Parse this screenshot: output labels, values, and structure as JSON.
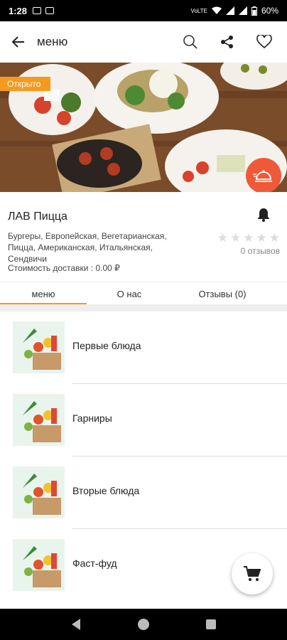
{
  "status_bar": {
    "time": "1:28",
    "battery": "60%",
    "network": "VoLTE"
  },
  "app_bar": {
    "title": "меню",
    "back_icon": "arrow-left-icon",
    "search_icon": "search-icon",
    "share_icon": "share-icon",
    "favorite_icon": "heart-icon"
  },
  "hero": {
    "badge": "Открыто",
    "delivery_icon": "delivery-cloche-icon"
  },
  "restaurant": {
    "name": "ЛАВ Пицца",
    "cuisines": "Бургеры, Европейская, Вегетарианская, Пицца, Американская, Итальянская, Сендвичи",
    "delivery_cost": "Стоимость доставки : 0.00 ₽",
    "rating": 0,
    "reviews": "0 отзывов",
    "bell_icon": "bell-icon"
  },
  "tabs": [
    {
      "label": "меню",
      "active": true
    },
    {
      "label": "О нас",
      "active": false
    },
    {
      "label": "Отзывы (0)",
      "active": false
    }
  ],
  "menu": [
    {
      "label": "Первые блюда"
    },
    {
      "label": "Гарниры"
    },
    {
      "label": "Вторые блюда"
    },
    {
      "label": "Фаст-фуд"
    }
  ],
  "cart_icon": "cart-icon",
  "colors": {
    "accent": "#f39a20",
    "delivery": "#ee5a38"
  }
}
